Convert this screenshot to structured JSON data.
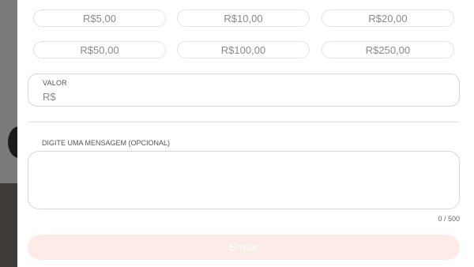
{
  "amounts": {
    "row1": [
      "R$5,00",
      "R$10,00",
      "R$20,00"
    ],
    "row2": [
      "R$50,00",
      "R$100,00",
      "R$250,00"
    ]
  },
  "valor": {
    "label": "VALOR",
    "prefix": "R$",
    "value": ""
  },
  "message": {
    "label": "DIGITE UMA MENSAGEM (OPCIONAL)",
    "value": "",
    "counter": "0 / 500"
  },
  "submit": {
    "label": "Enviar"
  },
  "colors": {
    "submit_bg": "#fdebe7",
    "border": "#d8d8d8"
  }
}
